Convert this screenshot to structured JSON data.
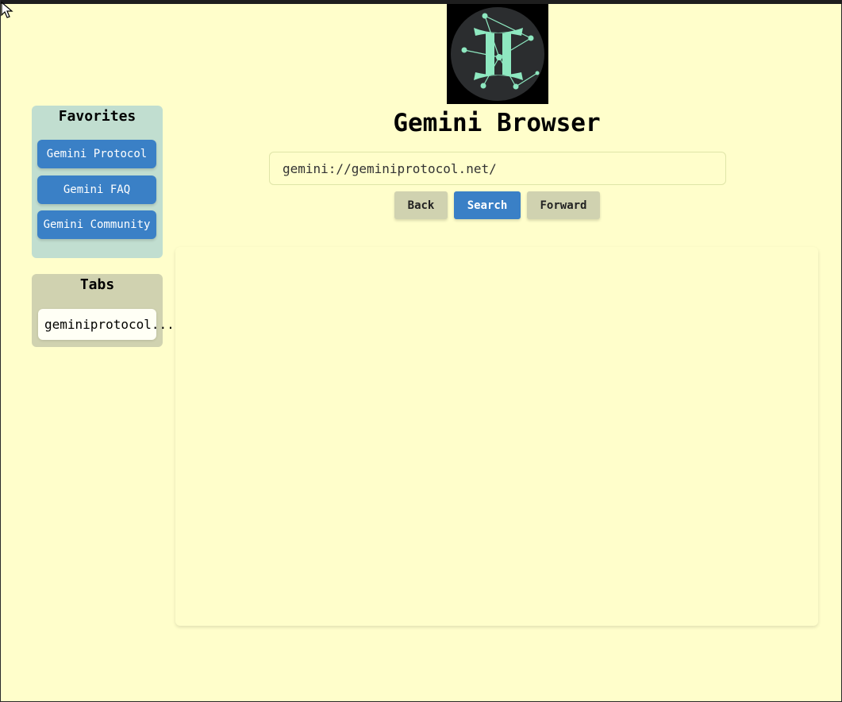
{
  "app": {
    "title": "Gemini Browser",
    "logo_icon": "gemini-constellation-icon"
  },
  "address_bar": {
    "value": "gemini://geminiprotocol.net/"
  },
  "navigation": {
    "back_label": "Back",
    "search_label": "Search",
    "forward_label": "Forward"
  },
  "favorites": {
    "heading": "Favorites",
    "items": [
      {
        "label": "Gemini Protocol"
      },
      {
        "label": "Gemini FAQ"
      },
      {
        "label": "Gemini Community"
      }
    ]
  },
  "tabs": {
    "heading": "Tabs",
    "items": [
      {
        "label": "geminiprotocol..."
      }
    ]
  },
  "colors": {
    "background": "#fffecb",
    "accent": "#3a80c6",
    "favorites_panel": "#c1ded0",
    "tabs_panel": "#d0d2b0",
    "logo_glyph": "#8ee8c0"
  }
}
